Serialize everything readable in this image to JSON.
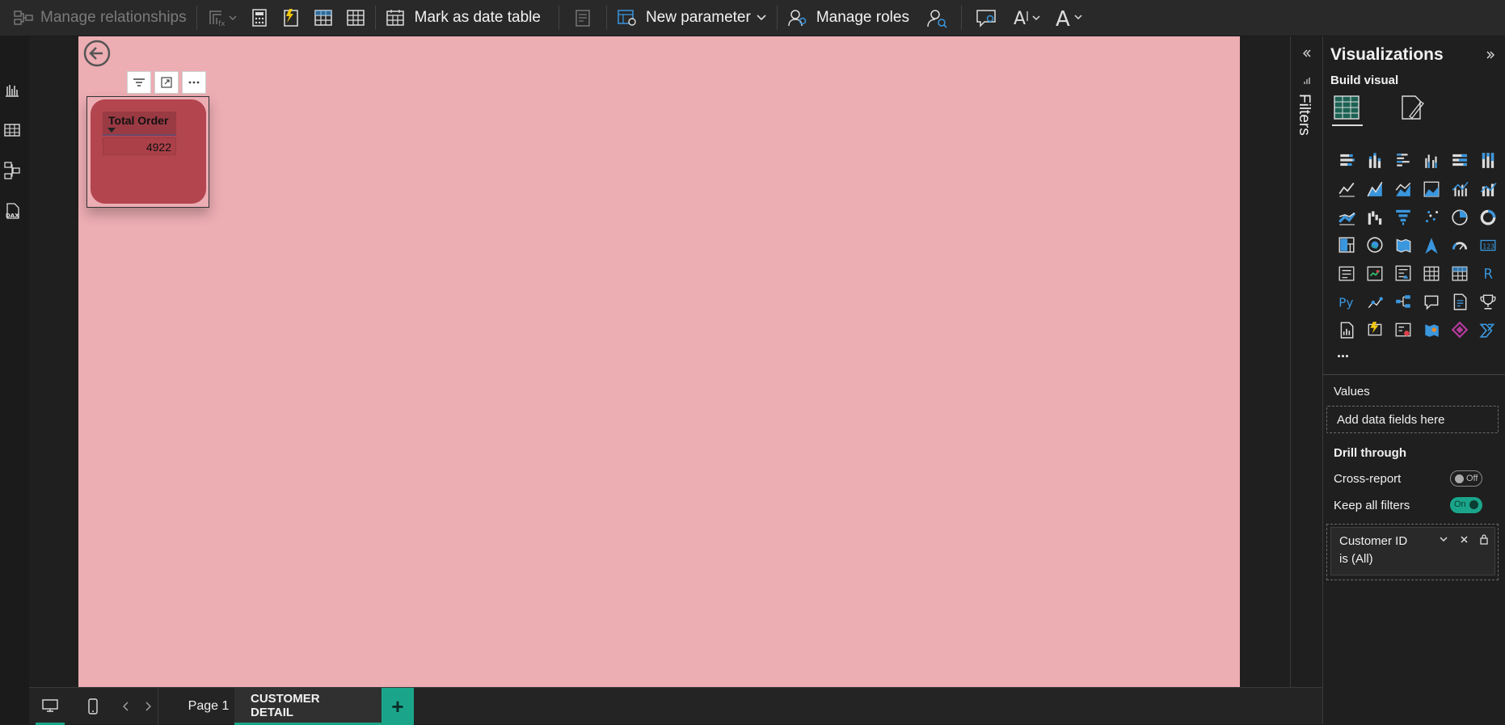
{
  "ribbon": {
    "manage_relationships": "Manage relationships",
    "mark_date_table": "Mark as date table",
    "new_parameter": "New parameter",
    "manage_roles": "Manage roles"
  },
  "visual": {
    "table_header": "Total Order",
    "table_value": "4922"
  },
  "filters_pane": {
    "label": "Filters"
  },
  "viz_pane": {
    "title": "Visualizations",
    "build_visual": "Build visual",
    "more": "...",
    "values_label": "Values",
    "values_placeholder": "Add data fields here",
    "drill_through": "Drill through",
    "cross_report": "Cross-report",
    "cross_report_state": "Off",
    "keep_filters": "Keep all filters",
    "keep_filters_state": "On",
    "filter_card": {
      "field": "Customer ID",
      "condition": "is (All)"
    }
  },
  "bottom": {
    "page1": "Page 1",
    "active_page": "CUSTOMER DETAIL",
    "add": "+"
  },
  "colors": {
    "accent": "#1aa58a",
    "canvas": "#ecadb3",
    "card": "#b2454e",
    "viz_blue": "#3a96dd"
  }
}
